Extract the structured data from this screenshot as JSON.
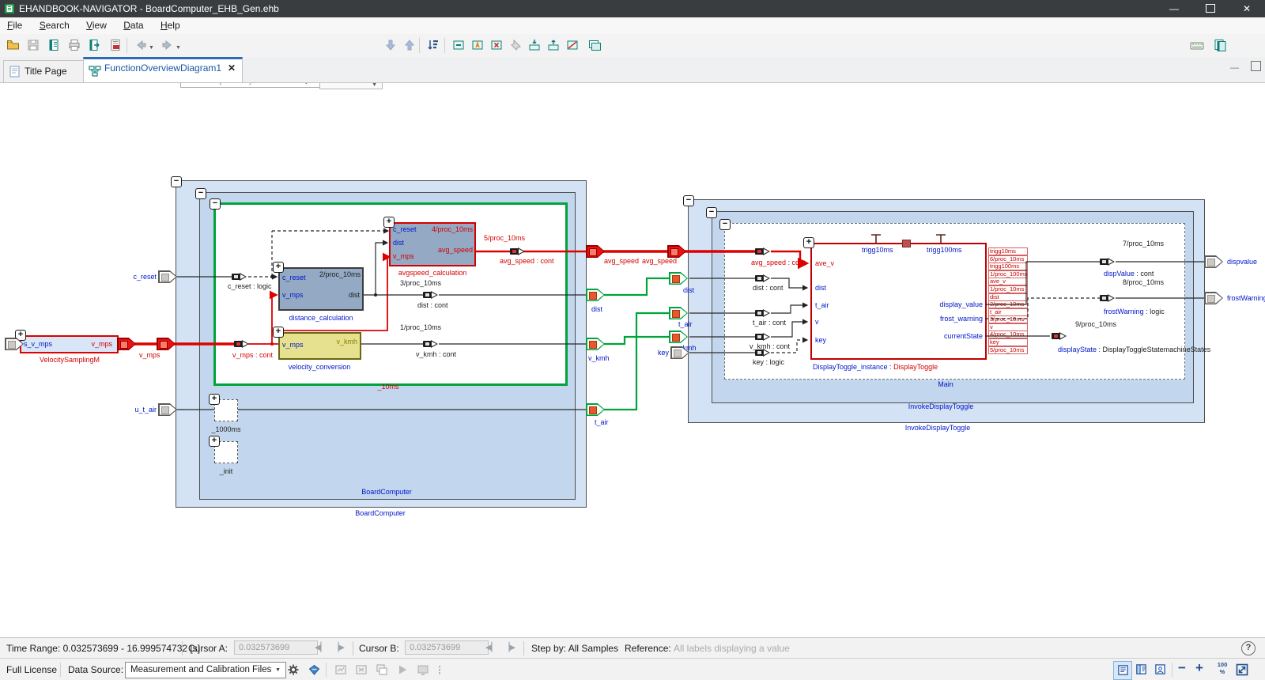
{
  "window": {
    "title": "EHANDBOOK-NAVIGATOR - BoardComputer_EHB_Gen.ehb"
  },
  "menu": {
    "items": [
      "File",
      "Search",
      "View",
      "Data",
      "Help"
    ]
  },
  "toolbar": {
    "search_placeholder": "Search (Ctrl+H)",
    "contains": "Contains"
  },
  "tabs": {
    "title_page": "Title Page",
    "diagram": "FunctionOverviewDiagram1"
  },
  "icons": {
    "caret": "▼",
    "close": "✕",
    "help": "?",
    "dots": "⋮",
    "step_back": "◀▏",
    "step_fwd": "▕▶",
    "zoom_out": "−",
    "zoom_in": "+",
    "zoom_pct": "100 %",
    "window_min": "—",
    "window_close": "✕",
    "panel_min": "—",
    "badge_minus": "−",
    "badge_plus": "+"
  },
  "statusbar": {
    "time_range": "Time Range: 0.032573699 - 16.999574732 [s]",
    "cursor_a_label": "Cursor A:",
    "cursor_a_value": "0.032573699",
    "cursor_b_label": "Cursor B:",
    "cursor_b_value": "0.032573699",
    "step_by": "Step by: All Samples",
    "reference_label": "Reference:",
    "reference_value": "All labels displaying a value"
  },
  "bottombar": {
    "license": "Full License",
    "data_source_label": "Data Source:",
    "data_source_value": "Measurement and Calibration Files"
  },
  "diagram": {
    "velocity_sampling": {
      "caption": "VelocitySamplingM",
      "in": "s_v_mps",
      "out": "v_mps"
    },
    "wire_v_mps": "v_mps",
    "conn_v_mps": "v_mps : cont",
    "in_c_reset": "c_reset",
    "conn_c_reset": "c_reset : logic",
    "in_u_t_air": "u_t_air",
    "board_outer": "BoardComputer",
    "board_inner": "BoardComputer",
    "grp_10ms": "_10ms",
    "grp_1000ms": "_1000ms",
    "grp_init": "_init",
    "distance": {
      "proc": "2/proc_10ms",
      "in1": "c_reset",
      "in2": "v_mps",
      "out": "dist",
      "caption": "distance_calculation"
    },
    "avgspeed": {
      "proc": "4/proc_10ms",
      "in1": "c_reset",
      "in2": "dist",
      "in3": "v_mps",
      "out": "avg_speed",
      "caption": "avgspeed_calculation"
    },
    "velocity_conv": {
      "in": "v_mps",
      "out": "v_kmh",
      "caption": "velocity_conversion"
    },
    "conn_dist": {
      "proc": "3/proc_10ms",
      "label": "dist : cont"
    },
    "conn_vkmh": {
      "proc": "1/proc_10ms",
      "label": "v_kmh : cont"
    },
    "conn_avg": {
      "proc": "5/proc_10ms",
      "label": "avg_speed : cont"
    },
    "mid_ports": {
      "avg_l": "avg_speed",
      "avg_r": "avg_speed",
      "dist_l": "dist",
      "vkmh_l": "v_kmh",
      "tair_l": "t_air",
      "dist_r": "dist",
      "tair_r": "t_air",
      "vkmh_r": "v_kmh",
      "key_r": "key"
    },
    "invoke_outer": "InvokeDisplayToggle",
    "invoke_inner": "InvokeDisplayToggle",
    "grp_main": "Main",
    "rconn": {
      "avg": "avg_speed : cont",
      "dist": "dist : cont",
      "tair": "t_air : cont",
      "vkmh": "v_kmh : cont",
      "key": "key : logic"
    },
    "dt": {
      "trig1": "trigg10ms",
      "trig2": "trigg100ms",
      "in1": "ave_v",
      "in2": "dist",
      "in3": "t_air",
      "in4": "v",
      "in5": "key",
      "out1": "display_value",
      "out2": "frost_warning",
      "out3": "currentState",
      "cap_name": "DisplayToggle_instance :",
      "cap_type": "DisplayToggle"
    },
    "red_stack": [
      "trigg10ms",
      "6/proc_10ms",
      "trigg100ms",
      "1/proc_100ms",
      "ave_v",
      "1/proc_10ms",
      "dist",
      "2/proc_10ms",
      "t_air",
      "3/proc_10ms",
      "v",
      "4/proc_10ms",
      "key",
      "5/proc_10ms"
    ],
    "out_disp": {
      "proc": "7/proc_10ms",
      "conn_name": "dispValue",
      "conn_type": " : cont",
      "port": "dispvalue"
    },
    "out_frost": {
      "proc": "8/proc_10ms",
      "conn_name": "frostWarning",
      "conn_type": " : logic",
      "port": "frostWarning"
    },
    "out_state": {
      "proc": "9/proc_10ms",
      "conn_name": "displayState",
      "conn_type": " : DisplayToggleStatemachineStates"
    }
  }
}
